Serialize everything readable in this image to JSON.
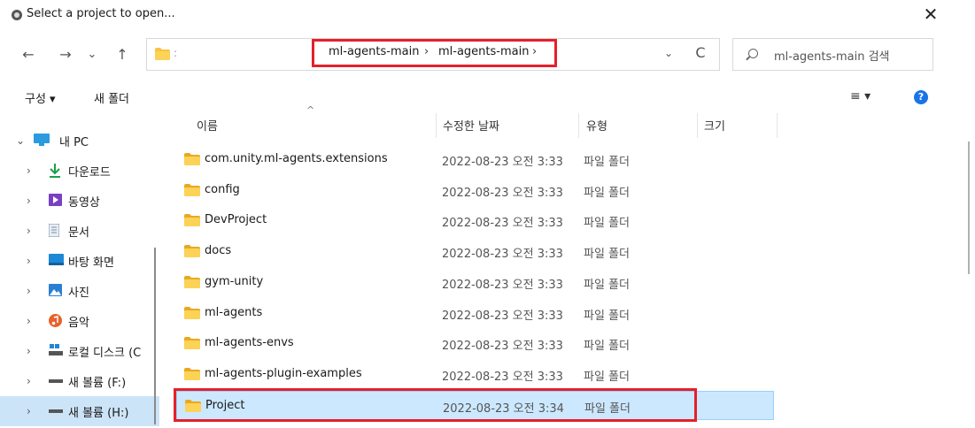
{
  "window": {
    "title": "Select a project to open...",
    "close_glyph": "✕"
  },
  "nav": {
    "back": "←",
    "forward": "→",
    "recent": "⌄",
    "up": "↑",
    "refresh": "C",
    "dropdown": "⌄"
  },
  "address": {
    "folder_icon": "folder-icon",
    "leading_sep": ":",
    "crumbs": [
      "ml-agents-main",
      "ml-agents-main"
    ],
    "crumb_sep": "›"
  },
  "search": {
    "placeholder": "ml-agents-main 검색",
    "icon": "search-icon"
  },
  "toolbar": {
    "organize": "구성 ▾",
    "new_folder": "새 폴더",
    "view": "≡ ▾",
    "help": "?"
  },
  "sidebar": {
    "items": [
      {
        "label": "내 PC",
        "chevron": "⌄",
        "icon": "pc-icon"
      },
      {
        "label": "다운로드",
        "chevron": "›",
        "icon": "download-icon"
      },
      {
        "label": "동영상",
        "chevron": "›",
        "icon": "video-icon"
      },
      {
        "label": "문서",
        "chevron": "›",
        "icon": "document-icon"
      },
      {
        "label": "바탕 화면",
        "chevron": "›",
        "icon": "desktop-icon"
      },
      {
        "label": "사진",
        "chevron": "›",
        "icon": "pictures-icon"
      },
      {
        "label": "음악",
        "chevron": "›",
        "icon": "music-icon"
      },
      {
        "label": "로컬 디스크 (C",
        "chevron": "›",
        "icon": "disk-icon"
      },
      {
        "label": "새 볼륨 (F:)",
        "chevron": "›",
        "icon": "drive-icon"
      },
      {
        "label": "새 볼륨 (H:)",
        "chevron": "›",
        "icon": "drive-icon"
      }
    ]
  },
  "columns": {
    "name": "이름",
    "date": "수정한 날짜",
    "type": "유형",
    "size": "크기",
    "sort_caret": "^"
  },
  "files": [
    {
      "name": "com.unity.ml-agents.extensions",
      "date": "2022-08-23 오전 3:33",
      "type": "파일 폴더"
    },
    {
      "name": "config",
      "date": "2022-08-23 오전 3:33",
      "type": "파일 폴더"
    },
    {
      "name": "DevProject",
      "date": "2022-08-23 오전 3:33",
      "type": "파일 폴더"
    },
    {
      "name": "docs",
      "date": "2022-08-23 오전 3:33",
      "type": "파일 폴더"
    },
    {
      "name": "gym-unity",
      "date": "2022-08-23 오전 3:33",
      "type": "파일 폴더"
    },
    {
      "name": "ml-agents",
      "date": "2022-08-23 오전 3:33",
      "type": "파일 폴더"
    },
    {
      "name": "ml-agents-envs",
      "date": "2022-08-23 오전 3:33",
      "type": "파일 폴더"
    },
    {
      "name": "ml-agents-plugin-examples",
      "date": "2022-08-23 오전 3:33",
      "type": "파일 폴더"
    },
    {
      "name": "Project",
      "date": "2022-08-23 오전 3:34",
      "type": "파일 폴더",
      "selected": true
    }
  ],
  "colors": {
    "highlight": "#e5202a",
    "selection": "#cce8ff",
    "folder": "#f8c440"
  }
}
